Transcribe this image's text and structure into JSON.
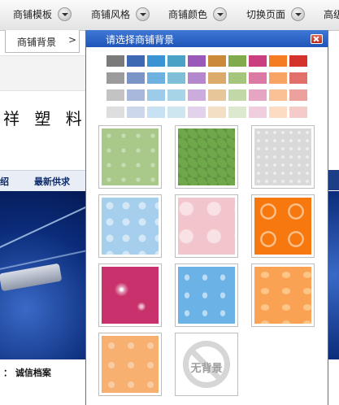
{
  "toolbar": {
    "items": [
      {
        "label": "商铺模板"
      },
      {
        "label": "商铺风格"
      },
      {
        "label": "商铺颜色"
      },
      {
        "label": "切换页面"
      },
      {
        "label": "高级"
      }
    ]
  },
  "tab": {
    "label": "商铺背景",
    "chevron": ">"
  },
  "background_page": {
    "title": "祥 塑 料 再",
    "nav": [
      "绍",
      "最新供求"
    ],
    "footer_text": "： 诚信档案"
  },
  "dialog": {
    "title": "请选择商铺背景",
    "close_icon": "close-icon",
    "swatches": [
      [
        "#7a7a7a",
        "#3f68b3",
        "#3a93d2",
        "#4aa3c7",
        "#9a58b8",
        "#cb8a3a",
        "#80ab4c",
        "#c93f7f",
        "#f47d23",
        "#d4322c"
      ],
      [
        "#9b9b9b",
        "#7a94c6",
        "#6eb1e0",
        "#80bfd8",
        "#b587cc",
        "#dbab6c",
        "#a5c57d",
        "#da7aa5",
        "#f8a464",
        "#e2706a"
      ],
      [
        "#c3c3c3",
        "#a7b8dc",
        "#9dcbea",
        "#a7d4e6",
        "#ccacdc",
        "#e7c699",
        "#c2d8a6",
        "#e6a5c3",
        "#fbc196",
        "#eca19c"
      ],
      [
        "#dedede",
        "#cdd7ec",
        "#c8e1f3",
        "#cde6f0",
        "#e2d2ec",
        "#f2dfc4",
        "#dde9cf",
        "#f1cde0",
        "#fddcc4",
        "#f4cbc8"
      ]
    ],
    "backgrounds": [
      {
        "name": "light-green-pattern",
        "color": "#a8c98a"
      },
      {
        "name": "green-diamond-pattern",
        "color": "#6fa84a"
      },
      {
        "name": "light-gray-pattern",
        "color": "#d9d9d9"
      },
      {
        "name": "light-blue-floral",
        "color": "#a6cfee"
      },
      {
        "name": "pink-floral",
        "color": "#f2c4cc"
      },
      {
        "name": "orange-coin-pattern",
        "color": "#f6780e"
      },
      {
        "name": "magenta-sparkle",
        "color": "#c8316b"
      },
      {
        "name": "blue-water-drops",
        "color": "#6bb2e6"
      },
      {
        "name": "orange-ingot-pattern",
        "color": "#f9a253"
      },
      {
        "name": "peach-star-pattern",
        "color": "#f8b071"
      },
      {
        "name": "no-background",
        "label": "无背景"
      }
    ]
  }
}
